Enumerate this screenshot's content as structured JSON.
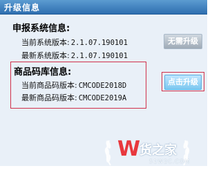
{
  "window": {
    "title": "升级信息"
  },
  "declare_system": {
    "heading": "申报系统信息:",
    "current_label": "当前系统版本:",
    "current_value": "2.1.07.190101",
    "latest_label": "最新系统版本:",
    "latest_value": "2.1.07.190101",
    "button_label": "无需升级"
  },
  "product_code": {
    "heading": "商品码库信息:",
    "current_label": "当前商品码版本:",
    "current_value": "CMCODE2018D",
    "latest_label": "最新商品码版本:",
    "latest_value": "CMCODE2019A",
    "button_label": "点击升级"
  },
  "watermark": {
    "logo_letter": "W",
    "text": "货之家",
    "sub": "51W2C.COM"
  },
  "colors": {
    "titlebar": "#2f6fb0",
    "panel": "#e9f0f8",
    "highlight": "#d0304a",
    "active_button": "#7cc8f0"
  }
}
